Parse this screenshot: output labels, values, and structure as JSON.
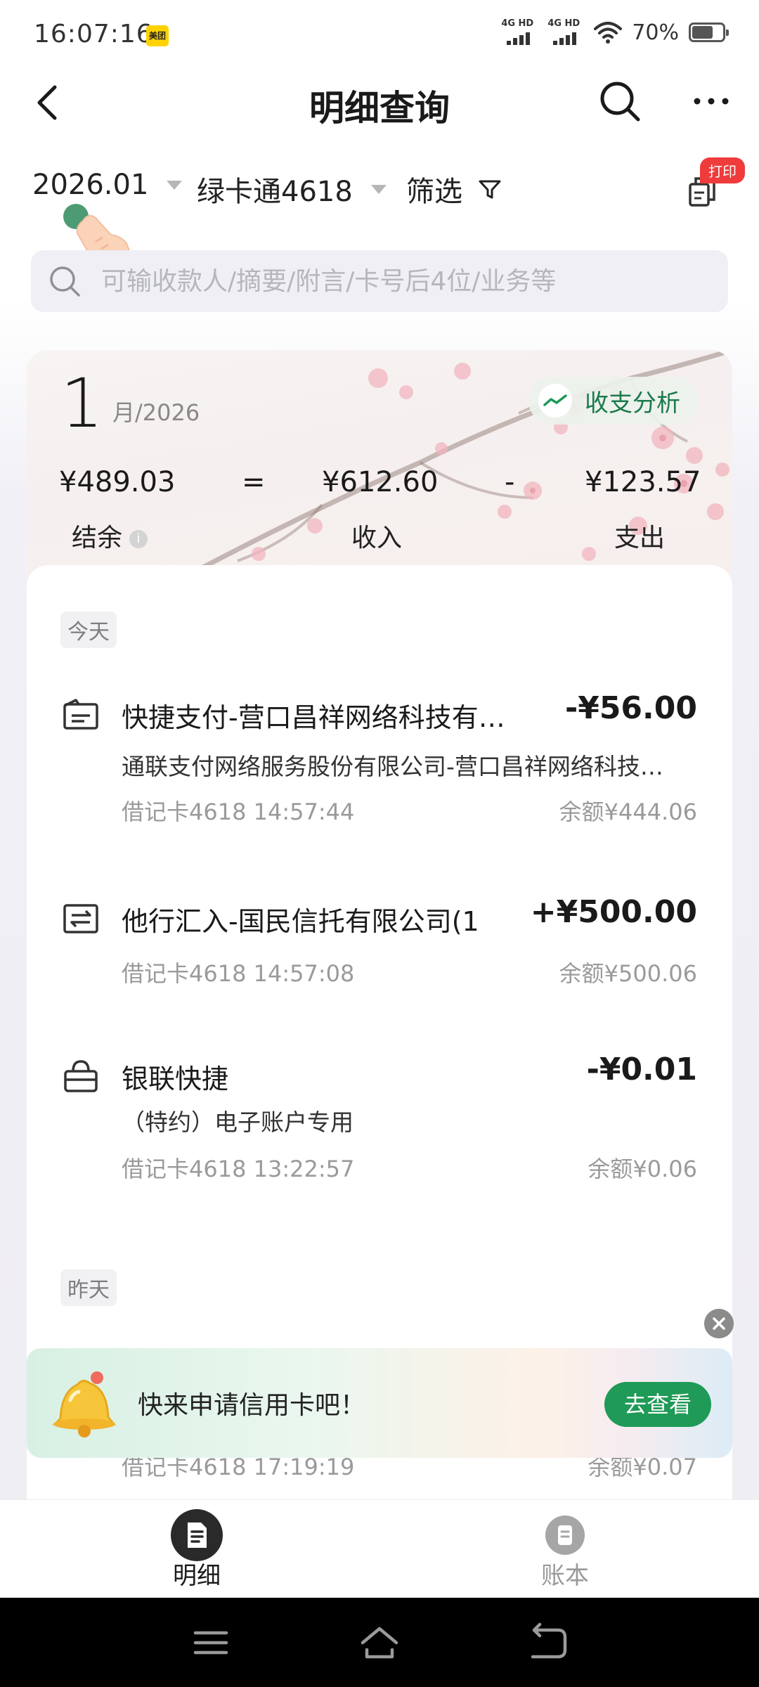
{
  "status_bar": {
    "time": "16:07:16",
    "app_badge": "美团",
    "network_1": "4G HD",
    "network_2": "4G HD",
    "battery": "70%"
  },
  "header": {
    "title": "明细查询"
  },
  "filters": {
    "month": "2026.01",
    "card": "绿卡通4618",
    "screen": "筛选",
    "print_badge": "打印"
  },
  "search": {
    "placeholder": "可输收款人/摘要/附言/卡号后4位/业务等"
  },
  "summary": {
    "month_number": "1",
    "month_year": "月/2026",
    "analysis_label": "收支分析",
    "balance": "¥489.03",
    "equals": "=",
    "income": "¥612.60",
    "minus": "-",
    "expense": "¥123.57",
    "balance_label": "结余",
    "info_icon": "i",
    "income_label": "收入",
    "expense_label": "支出"
  },
  "groups": [
    {
      "day": "今天",
      "transactions": [
        {
          "icon": "receipt-icon",
          "name": "快捷支付-营口昌祥网络科技有限公司",
          "amount": "-¥56.00",
          "desc": "通联支付网络服务股份有限公司-营口昌祥网络科技有限公司",
          "meta": "借记卡4618 14:57:44",
          "balance": "余额¥444.06"
        },
        {
          "icon": "transfer-icon",
          "name": "他行汇入-国民信托有限公司(1",
          "amount": "+¥500.00",
          "desc": "",
          "meta": "借记卡4618 14:57:08",
          "balance": "余额¥500.06"
        },
        {
          "icon": "basket-icon",
          "name": "银联快捷",
          "amount": "-¥0.01",
          "desc": "（特约）电子账户专用",
          "meta": "借记卡4618 13:22:57",
          "balance": "余额¥0.06"
        }
      ]
    },
    {
      "day": "昨天",
      "transactions": [
        {
          "meta": "借记卡4618 17:19:19",
          "balance": "余额¥0.07"
        }
      ]
    }
  ],
  "promo": {
    "text": "快来申请信用卡吧！",
    "button": "去查看"
  },
  "bottom_nav": {
    "detail": "明细",
    "book": "账本"
  },
  "colors": {
    "accent_green": "#1f9a57",
    "analysis_text": "#1b7a4c",
    "badge_red": "#ef3b3b"
  }
}
